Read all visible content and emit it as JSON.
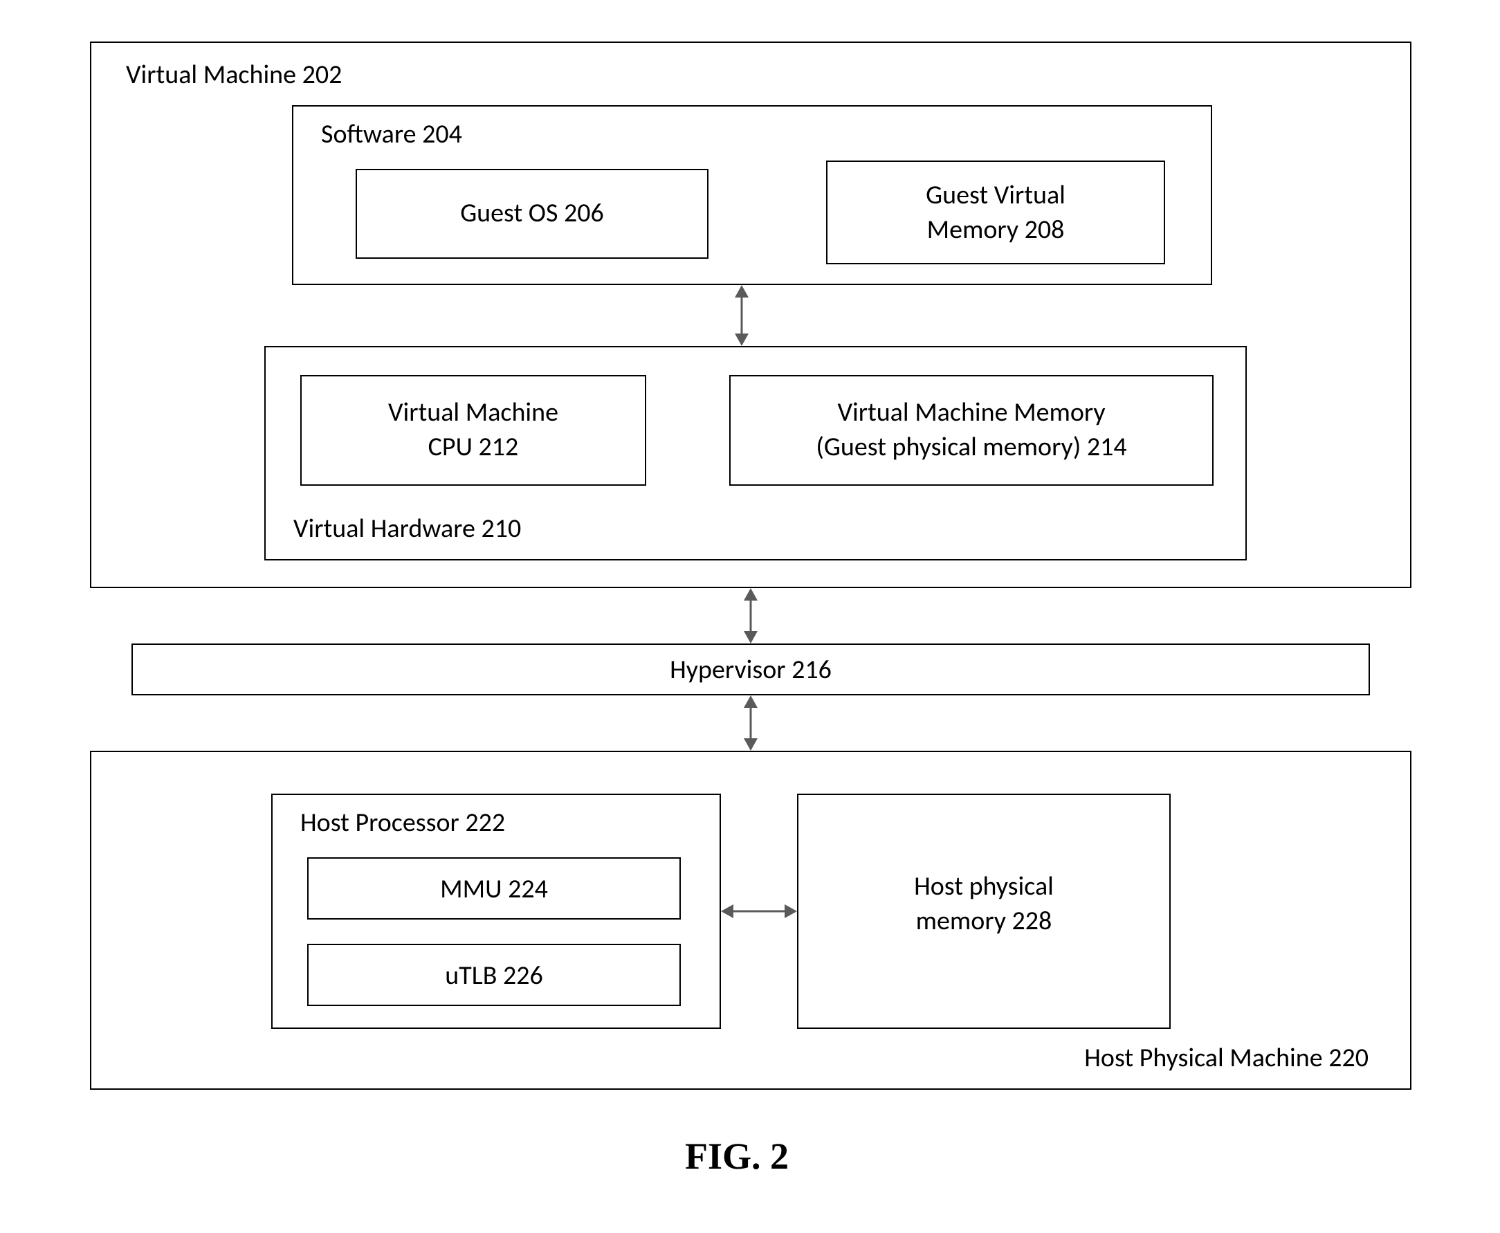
{
  "figure_caption": "FIG. 2",
  "vm": {
    "title": "Virtual Machine 202",
    "software": {
      "title": "Software 204",
      "guest_os": "Guest OS 206",
      "guest_virt_mem_l1": "Guest Virtual",
      "guest_virt_mem_l2": "Memory 208"
    },
    "virtual_hw": {
      "title": "Virtual Hardware  210",
      "vm_cpu_l1": "Virtual Machine",
      "vm_cpu_l2": "CPU 212",
      "vm_mem_l1": "Virtual Machine Memory",
      "vm_mem_l2": "(Guest physical memory) 214"
    }
  },
  "hypervisor": "Hypervisor  216",
  "host": {
    "title": "Host Physical Machine  220",
    "proc": {
      "title": "Host Processor 222",
      "mmu": "MMU 224",
      "utlb": "uTLB 226"
    },
    "mem_l1": "Host physical",
    "mem_l2": "memory 228"
  }
}
